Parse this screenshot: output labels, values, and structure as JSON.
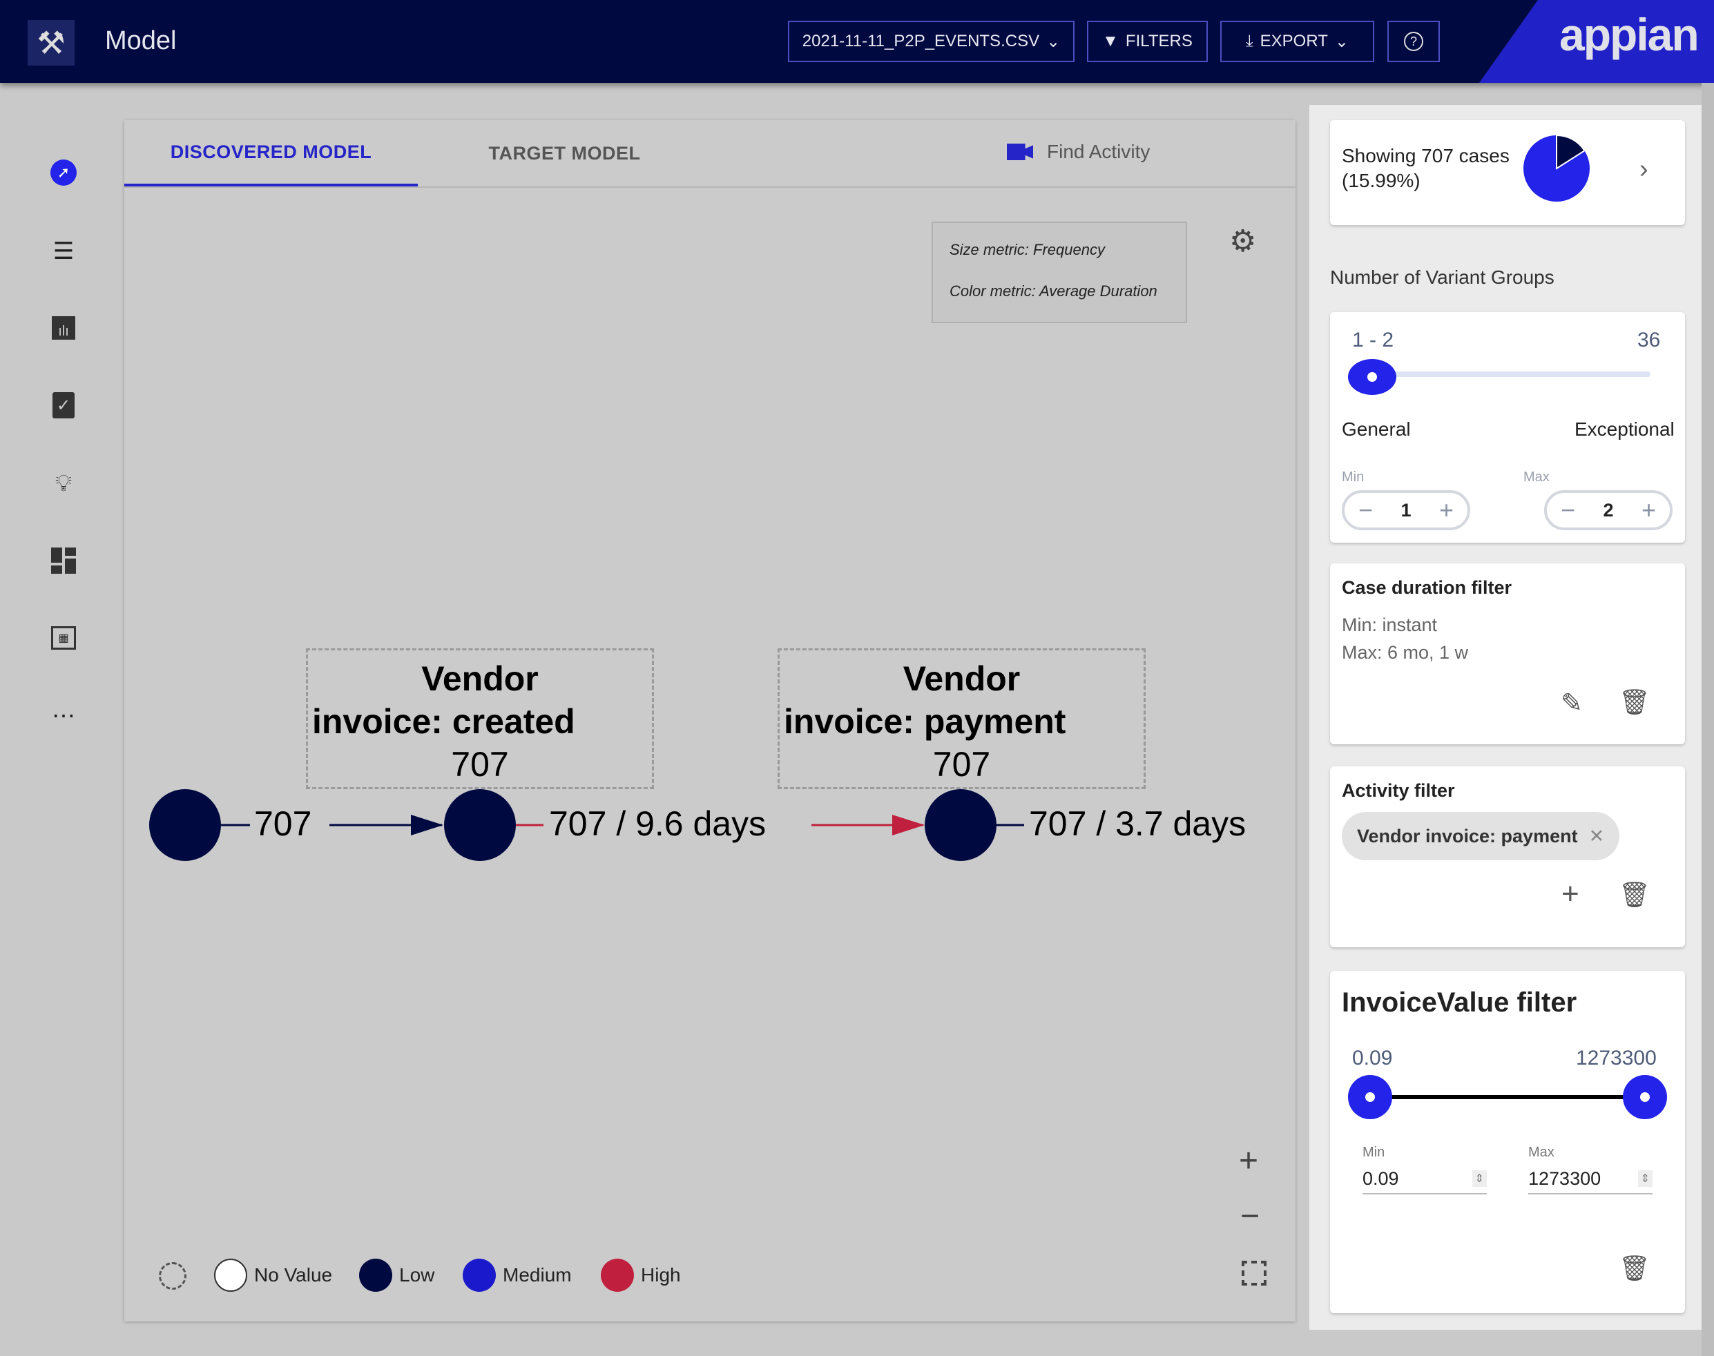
{
  "header": {
    "title": "Model",
    "file_select": "2021-11-11_P2P_EVENTS.CSV",
    "filters": "FILTERS",
    "export": "EXPORT",
    "help_icon": "help-circle-icon",
    "logo": "appian"
  },
  "sidebar": {
    "items": [
      "compass-icon",
      "list-icon",
      "bar-chart-icon",
      "clipboard-check-icon",
      "lightbulb-icon",
      "dashboard-icon",
      "report-icon",
      "more-icon"
    ]
  },
  "tabs": [
    {
      "label": "DISCOVERED MODEL",
      "active": true
    },
    {
      "label": "TARGET MODEL",
      "active": false
    }
  ],
  "find_activity": "Find Activity",
  "metrics": {
    "size": "Size metric: Frequency",
    "color": "Color metric: Average Duration"
  },
  "graph": {
    "start_count": "707",
    "nodes": [
      {
        "label": "Vendor invoice: created",
        "line1": "Vendor",
        "line2": "invoice: created",
        "count": "707",
        "edge": "707 / 9.6 days"
      },
      {
        "label": "Vendor invoice: payment",
        "line1": "Vendor",
        "line2": "invoice: payment",
        "count": "707",
        "edge": "707 / 3.7 days"
      }
    ]
  },
  "legend": [
    {
      "label": "No Value",
      "color": "#ffffff"
    },
    {
      "label": "Low",
      "color": "#000940"
    },
    {
      "label": "Medium",
      "color": "#1a1acc"
    },
    {
      "label": "High",
      "color": "#c0203e"
    }
  ],
  "cases": {
    "text1": "Showing 707 cases",
    "text2": "(15.99%)",
    "fraction": 0.1599,
    "colors": {
      "selected": "#000940",
      "rest": "#2323ea"
    }
  },
  "variant_groups": {
    "title": "Number of Variant Groups",
    "range": "1 - 2",
    "max_total": "36",
    "left_label": "General",
    "right_label": "Exceptional",
    "min_label": "Min",
    "min_value": "1",
    "max_label": "Max",
    "max_value": "2"
  },
  "case_duration": {
    "title": "Case duration filter",
    "min": "Min: instant",
    "max": "Max: 6 mo, 1 w"
  },
  "activity_filter": {
    "title": "Activity filter",
    "chip": "Vendor invoice: payment"
  },
  "invoice_filter": {
    "title": "InvoiceValue filter",
    "low": "0.09",
    "high": "1273300",
    "min_label": "Min",
    "min_value": "0.09",
    "max_label": "Max",
    "max_value": "1273300"
  },
  "accent": "#2323ea"
}
